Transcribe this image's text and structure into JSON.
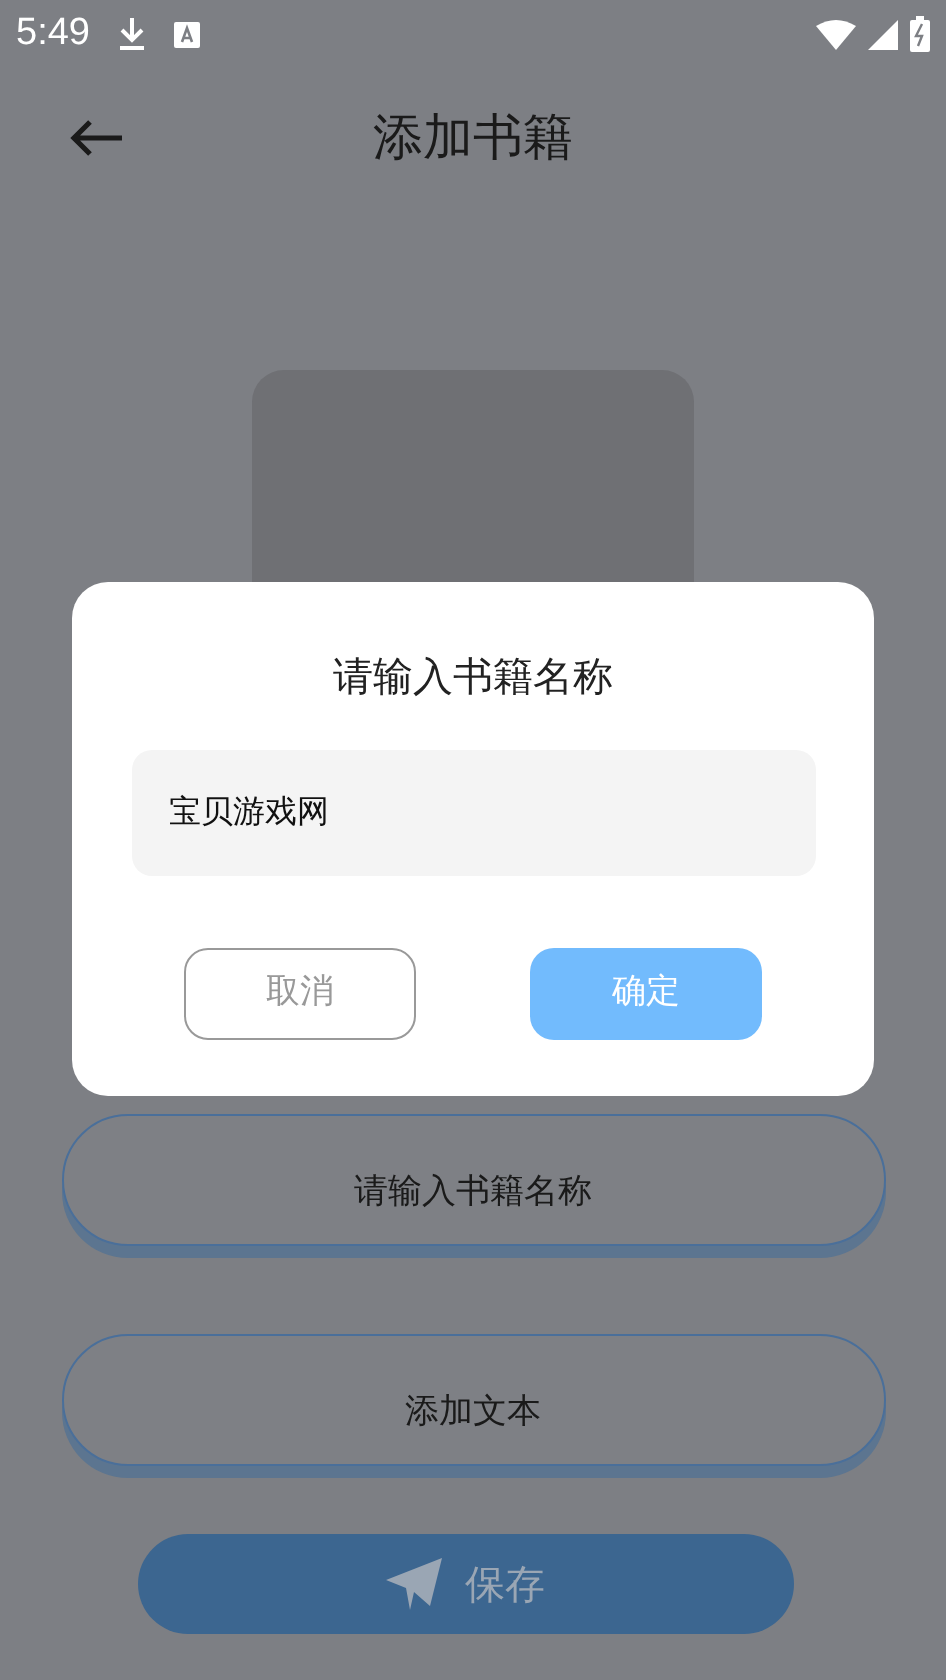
{
  "status_bar": {
    "time": "5:49"
  },
  "header": {
    "title": "添加书籍"
  },
  "form": {
    "name_button": "请输入书籍名称",
    "text_button": "添加文本",
    "save_button": "保存"
  },
  "dialog": {
    "title": "请输入书籍名称",
    "value": "宝贝游戏网",
    "buttons": [
      {
        "label": "取消",
        "kind": "cancel"
      },
      {
        "label": "确定",
        "kind": "confirm"
      }
    ]
  }
}
